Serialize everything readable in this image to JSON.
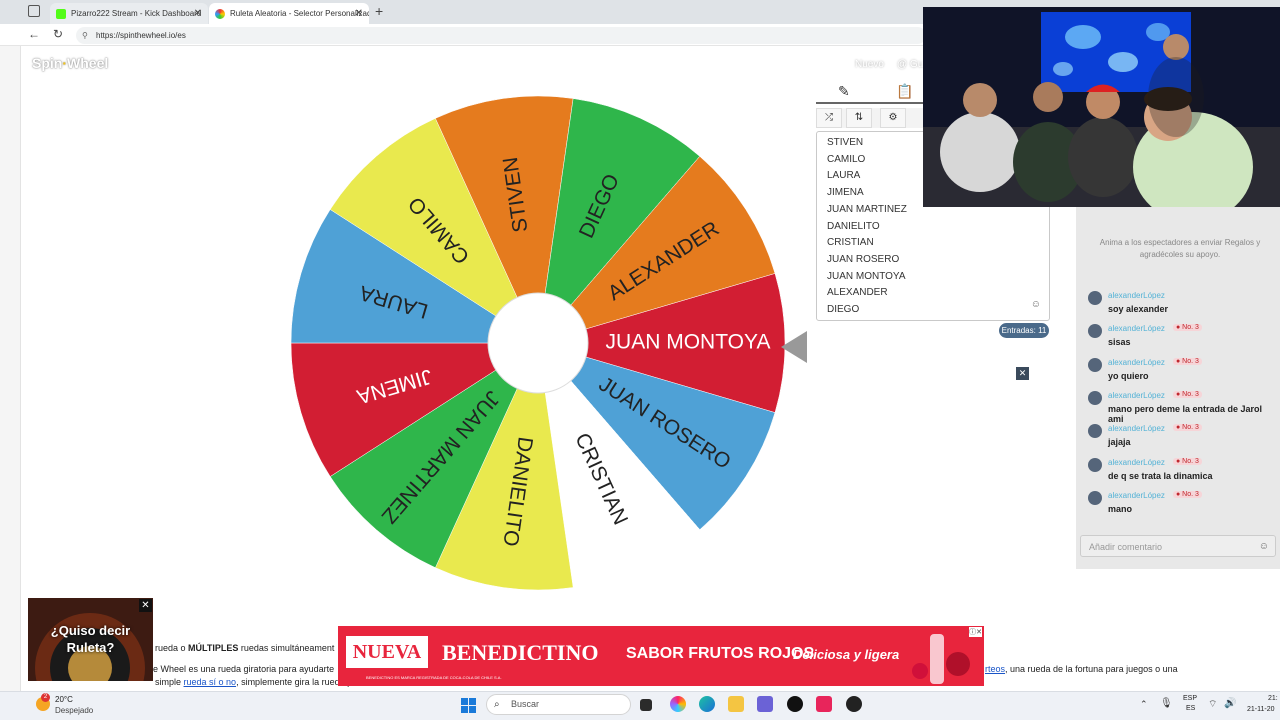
{
  "browser": {
    "tabs": [
      {
        "title": "Pizarro222 Stream - Kick Dashboard"
      },
      {
        "title": "Ruleta Aleatoria - Selector Personalizado"
      }
    ],
    "new_tab_symbol": "+",
    "url": "https://spinthewheel.io/es"
  },
  "site": {
    "logo_part1": "Spin",
    "logo_part2": "Wheel",
    "nav_new": "Nuevo",
    "nav_other": "@ Gu"
  },
  "editor": {
    "entries": [
      "STIVEN",
      "CAMILO",
      "LAURA",
      "JIMENA",
      "JUAN MARTINEZ",
      "DANIELITO",
      "CRISTIAN",
      "JUAN ROSERO",
      "JUAN MONTOYA",
      "ALEXANDER",
      "DIEGO"
    ],
    "count_label": "Entradas: 11",
    "tools": [
      "shuffle-icon",
      "sort-icon",
      "settings-icon"
    ]
  },
  "wheel": {
    "segments": [
      {
        "label": "JUAN MONTOYA",
        "color": "#d21e33",
        "text": "#ffffff"
      },
      {
        "label": "JUAN ROSERO",
        "color": "#4fa1d6",
        "text": "#222222"
      },
      {
        "label": "CRISTIAN",
        "color": "#ffffff",
        "text": "#222222"
      },
      {
        "label": "DANIELITO",
        "color": "#e9e94e",
        "text": "#222222"
      },
      {
        "label": "JUAN MARTINEZ",
        "color": "#2fb64b",
        "text": "#222222"
      },
      {
        "label": "JIMENA",
        "color": "#d21e33",
        "text": "#ffffff"
      },
      {
        "label": "LAURA",
        "color": "#4fa1d6",
        "text": "#222222"
      },
      {
        "label": "CAMILO",
        "color": "#e9e94e",
        "text": "#222222"
      },
      {
        "label": "STIVEN",
        "color": "#e57b1e",
        "text": "#222222"
      },
      {
        "label": "DIEGO",
        "color": "#2fb64b",
        "text": "#222222"
      },
      {
        "label": "ALEXANDER",
        "color": "#e57b1e",
        "text": "#222222"
      }
    ]
  },
  "chat": {
    "empty_text": "Anima a los espectadores a enviar Regalos y agradécoles su apoyo.",
    "messages": [
      {
        "user": "alexanderLópez",
        "badge": "",
        "text": "soy alexander"
      },
      {
        "user": "alexanderLópez",
        "badge": "No. 3",
        "text": "sisas"
      },
      {
        "user": "alexanderLópez",
        "badge": "No. 3",
        "text": "yo quiero"
      },
      {
        "user": "alexanderLópez",
        "badge": "No. 3",
        "text": "mano pero deme la entrada de Jarol ami"
      },
      {
        "user": "alexanderLópez",
        "badge": "No. 3",
        "text": "jajaja"
      },
      {
        "user": "alexanderLópez",
        "badge": "No. 3",
        "text": "de q se trata la dinamica"
      },
      {
        "user": "alexanderLópez",
        "badge": "No. 3",
        "text": "mano"
      }
    ],
    "input_placeholder": "Añadir comentario"
  },
  "ads": {
    "box_text": "¿Quiso decir Ruleta?",
    "banner_nueva": "NUEVA",
    "banner_brand": "BENEDICTINO",
    "banner_flavor": "SABOR FRUTOS ROJOS",
    "banner_tagline": "Deliciosa y ligera",
    "banner_fine": "BENEDICTINO ES MARCA REGISTRADA DE COCA-COLA DE CHILE S.A."
  },
  "page_text": {
    "line1_a": "rueda o ",
    "line1_b": "MÚLTIPLES",
    "line1_c": " ruedas simultáneament",
    "line2": "e Wheel es una rueda giratoria para ayudarte",
    "line3_a": "simple ",
    "line3_link": "rueda sí o no",
    "line3_b": ", simplemente gira la rueda par",
    "line4_link": "rteos",
    "line4_b": ", una rueda de la fortuna para juegos o una"
  },
  "taskbar": {
    "weather_temp": "20°C",
    "weather_desc": "Despejado",
    "search_placeholder": "Buscar",
    "lang_top": "ESP",
    "lang_bottom": "ES",
    "time": "21:",
    "date": "21-11-20",
    "notif_count": "2"
  },
  "colors": {
    "accent_red": "#e8253d",
    "chat_username": "#53b2d6"
  }
}
